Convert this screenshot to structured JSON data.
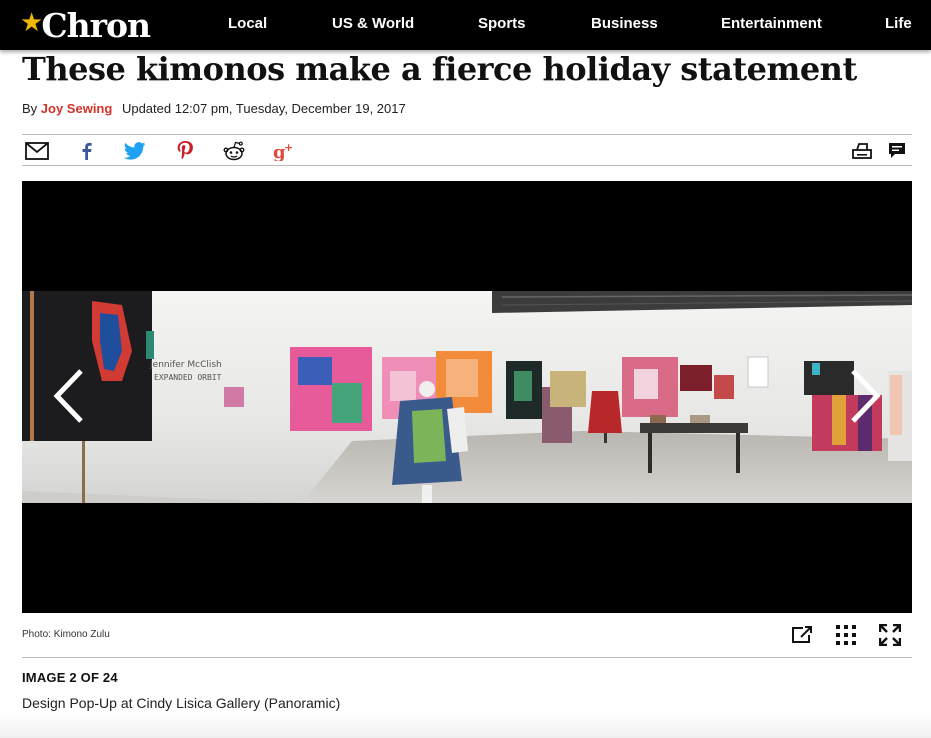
{
  "site": {
    "logo_text": "Chron",
    "nav": [
      "Local",
      "US & World",
      "Sports",
      "Business",
      "Entertainment",
      "Life"
    ]
  },
  "article": {
    "headline": "These kimonos make a fierce holiday statement",
    "by_label": "By",
    "author": "Joy Sewing",
    "updated": "Updated 12:07 pm, Tuesday, December 19, 2017"
  },
  "share": {
    "icons": [
      "email-icon",
      "facebook-icon",
      "twitter-icon",
      "pinterest-icon",
      "reddit-icon",
      "google-plus-icon"
    ],
    "right_icons": [
      "print-icon",
      "comment-icon"
    ],
    "colors": {
      "facebook": "#3b5998",
      "twitter": "#1da1f2",
      "pinterest": "#cb2027",
      "google_plus": "#dd4b39",
      "author": "#d3342a",
      "logo_star": "#f2b705"
    }
  },
  "gallery": {
    "wall_text_line1": "Jennifer McClish",
    "wall_text_line2": "EXPANDED ORBIT",
    "photo_credit": "Photo: Kimono Zulu",
    "image_count": "IMAGE 2 OF 24",
    "caption": "Design Pop-Up at Cindy Lisica Gallery (Panoramic)"
  }
}
